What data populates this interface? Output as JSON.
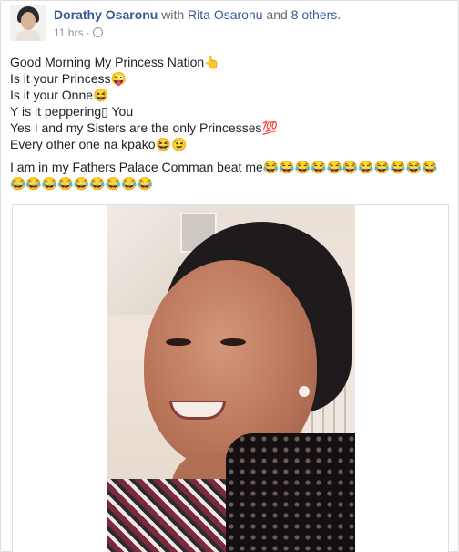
{
  "post": {
    "author": "Dorathy Osaronu",
    "with_text": "with",
    "tagged_person": "Rita Osaronu",
    "and_text": "and",
    "others": "8 others.",
    "time": "11 hrs",
    "privacy_icon": "globe-icon"
  },
  "body_lines": [
    "Good Morning My Princess Nation👆",
    "Is it your Princess😜",
    "Is it your Onne😆",
    "Y is it peppering▯ You",
    "Yes I and my Sisters are the only Princesses💯",
    "Every other one na kpako😆😉"
  ],
  "body_last": "I am in my Fathers Palace Comman beat me😂😂😂😂😂😂😂😂😂😂😂😂😂😂😂😂😂😂😂😂",
  "colors": {
    "link": "#385898",
    "text": "#1d2129",
    "meta": "#90949c",
    "border": "#dddfe2"
  }
}
